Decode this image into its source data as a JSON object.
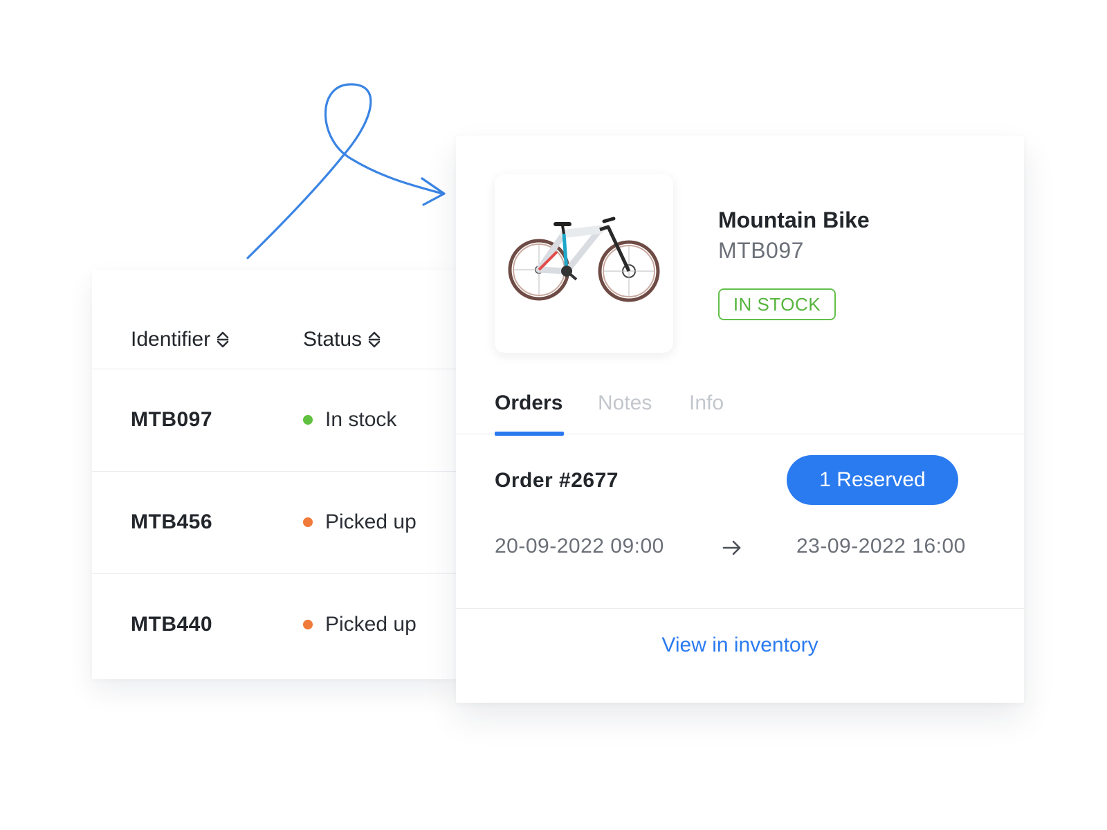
{
  "table": {
    "headers": {
      "identifier": "Identifier",
      "status": "Status"
    },
    "rows": [
      {
        "id": "MTB097",
        "status": "In stock",
        "status_color": "#5fc13f"
      },
      {
        "id": "MTB456",
        "status": "Picked up",
        "status_color": "#f07a3a"
      },
      {
        "id": "MTB440",
        "status": "Picked up",
        "status_color": "#f07a3a"
      }
    ]
  },
  "detail": {
    "product_name": "Mountain Bike",
    "product_id": "MTB097",
    "stock_badge": "IN STOCK",
    "tabs": [
      {
        "label": "Orders",
        "active": true
      },
      {
        "label": "Notes",
        "active": false
      },
      {
        "label": "Info",
        "active": false
      }
    ],
    "order": {
      "title": "Order #2677",
      "reserved_label": "1 Reserved",
      "start": "20-09-2022 09:00",
      "end": "23-09-2022 16:00"
    },
    "view_link": "View in inventory"
  },
  "colors": {
    "accent": "#2b7bf0",
    "in_stock": "#5fc13f",
    "picked_up": "#f07a3a"
  },
  "icons": {
    "sort": "sort-icon",
    "arrow": "arrow-right-icon",
    "product": "bike-image"
  }
}
